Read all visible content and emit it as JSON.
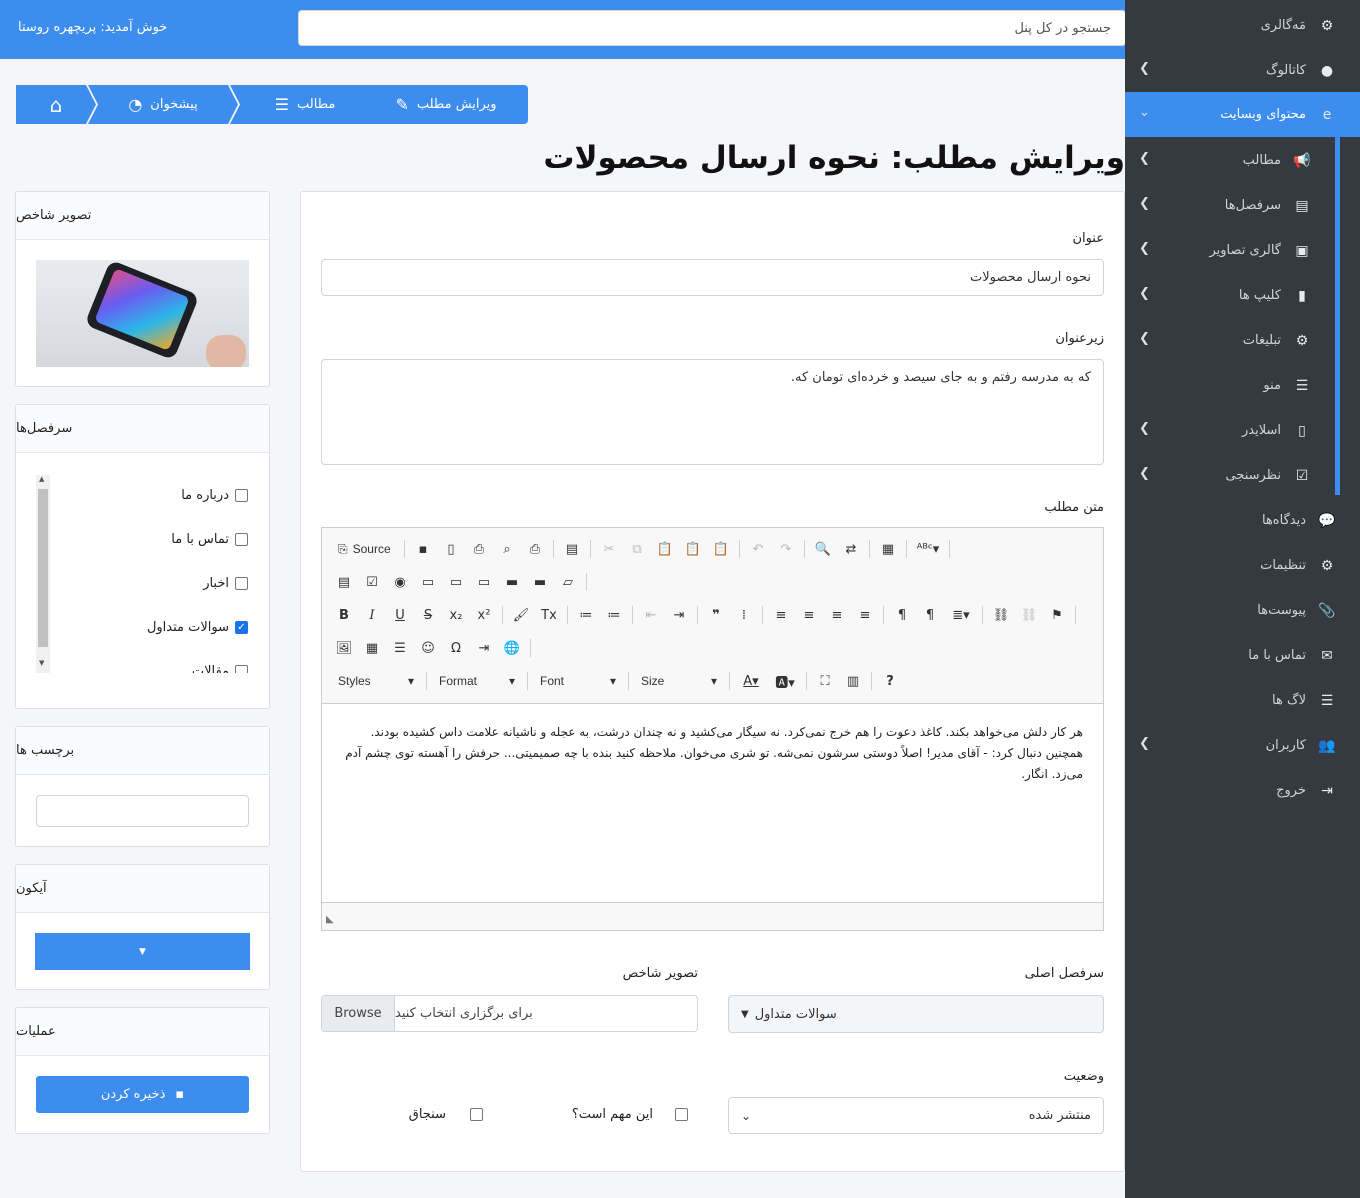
{
  "topbar": {
    "welcome": "خوش آمدید: پریچهره روستا",
    "search_placeholder": "جستجو در کل پنل"
  },
  "sidebar": {
    "items": [
      {
        "label": "مَه‌گالری",
        "icon": "gear-icon"
      },
      {
        "label": "کاتالوگ",
        "icon": "apple-icon"
      },
      {
        "label": "محتوای وبسایت",
        "icon": "globe-icon"
      },
      {
        "label": "مطالب",
        "icon": "megaphone-icon"
      },
      {
        "label": "سرفصل‌ها",
        "icon": "book-icon"
      },
      {
        "label": "گالری تصاویر",
        "icon": "images-icon"
      },
      {
        "label": "کلیپ ها",
        "icon": "video-file-icon"
      },
      {
        "label": "تبلیغات",
        "icon": "gear-icon"
      },
      {
        "label": "منو",
        "icon": "list-icon"
      },
      {
        "label": "اسلایدر",
        "icon": "image-file-icon"
      },
      {
        "label": "نظرسنجی",
        "icon": "poll-icon"
      },
      {
        "label": "دیدگاه‌ها",
        "icon": "comments-icon"
      },
      {
        "label": "تنظیمات",
        "icon": "cogs-icon"
      },
      {
        "label": "پیوست‌ها",
        "icon": "paperclip-icon"
      },
      {
        "label": "تماس با ما",
        "icon": "envelope-icon"
      },
      {
        "label": "لاگ ها",
        "icon": "list-icon"
      },
      {
        "label": "کاربران",
        "icon": "users-icon"
      },
      {
        "label": "خروج",
        "icon": "sign-out-icon"
      }
    ]
  },
  "breadcrumb": {
    "edit": "ویرایش مطلب",
    "posts": "مطالب",
    "dashboard": "پیشخوان"
  },
  "page": {
    "title": "ویرایش مطلب: نحوه ارسال محصولات"
  },
  "form": {
    "title_label": "عنوان",
    "title_value": "نحوه ارسال محصولات",
    "subtitle_label": "زیرعنوان",
    "subtitle_value": "که به مدرسه رفتم و به جای سیصد و خرده‌ای تومان که.",
    "body_label": "متن مطلب",
    "body_text": "هر کار دلش می‌خواهد بکند. کاغذ دعوت را هم خرج نمی‌کرد. نه سیگار می‌کشید و نه چندان درشت، به عجله و ناشیانه علامت داس کشیده بودند. همچنین دنبال کرد: - آقای مدیر! اصلاً دوستی سرشون نمی‌شه. تو شری می‌خوان. ملاحظه کنید بنده با چه صمیمیتی... حرفش را آهسته توی چشم آدم می‌زد. انگار.",
    "main_category_label": "سرفصل اصلی",
    "main_category_value": "سوالات متداول",
    "image_label": "تصویر شاخص",
    "browse": "Browse",
    "file_placeholder": "برای برگزاری انتخاب کنید",
    "status_label": "وضعیت",
    "status_value": "منتشر شده",
    "important_label": "این مهم است؟",
    "pin_label": "سنجاق"
  },
  "editor": {
    "source": "Source",
    "styles": "Styles",
    "format": "Format",
    "font": "Font",
    "size": "Size"
  },
  "right": {
    "image_card": "تصویر شاخص",
    "categories_card": "سرفصل‌ها",
    "categories": [
      {
        "label": "درباره ما",
        "checked": false
      },
      {
        "label": "تماس با ما",
        "checked": false
      },
      {
        "label": "اخبار",
        "checked": false
      },
      {
        "label": "سوالات متداول",
        "checked": true
      },
      {
        "label": "مقالات",
        "checked": false
      }
    ],
    "tags_card": "برچسب ها",
    "icon_card": "آیکون",
    "actions_card": "عملیات",
    "save": "ذخیره کردن"
  },
  "colors": {
    "accent": "#3c8dee",
    "sidebar": "#343a40"
  }
}
